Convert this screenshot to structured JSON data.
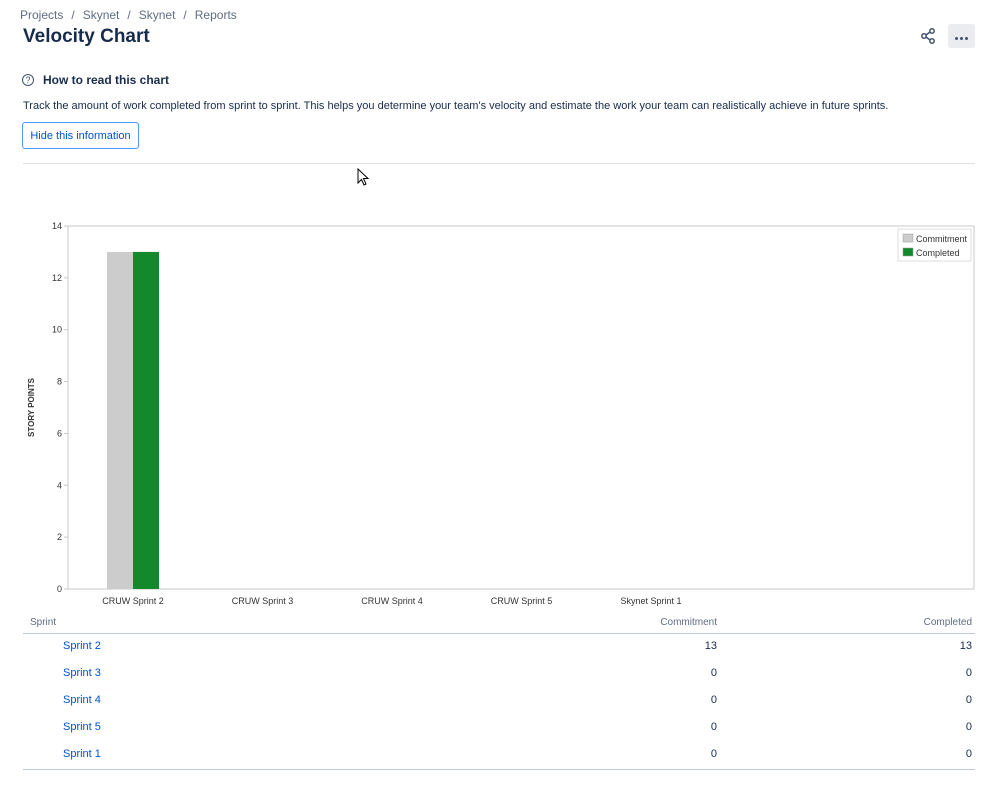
{
  "breadcrumbs": [
    "Projects",
    "Skynet",
    "Skynet",
    "Reports"
  ],
  "page": {
    "title": "Velocity Chart",
    "share_icon": "share-icon",
    "more_icon": "more-horizontal-icon"
  },
  "help": {
    "icon": "question-circle-icon",
    "icon_glyph": "?",
    "title": "How to read this chart",
    "text": "Track the amount of work completed from sprint to sprint. This helps you determine your team's velocity and estimate the work your team can realistically achieve in future sprints.",
    "hide_button": "Hide this information"
  },
  "chart_data": {
    "type": "bar",
    "ylabel": "STORY POINTS",
    "xlabel": "",
    "ylim": [
      0,
      14
    ],
    "yticks": [
      0,
      2,
      4,
      6,
      8,
      10,
      12,
      14
    ],
    "categories": [
      "CRUW Sprint 2",
      "CRUW Sprint 3",
      "CRUW Sprint 4",
      "CRUW Sprint 5",
      "Skynet Sprint 1"
    ],
    "series": [
      {
        "name": "Commitment",
        "values": [
          13,
          0,
          0,
          0,
          0
        ],
        "color": "#cccccc"
      },
      {
        "name": "Completed",
        "values": [
          13,
          0,
          0,
          0,
          0
        ],
        "color": "#14892c"
      }
    ],
    "legend": "top-right",
    "grid": false
  },
  "table": {
    "headers": {
      "sprint": "Sprint",
      "commitment": "Commitment",
      "completed": "Completed"
    },
    "rows": [
      {
        "sprint": "Sprint 2",
        "commitment": "13",
        "completed": "13"
      },
      {
        "sprint": "Sprint 3",
        "commitment": "0",
        "completed": "0"
      },
      {
        "sprint": "Sprint 4",
        "commitment": "0",
        "completed": "0"
      },
      {
        "sprint": "Sprint 5",
        "commitment": "0",
        "completed": "0"
      },
      {
        "sprint": "Sprint 1",
        "commitment": "0",
        "completed": "0"
      }
    ]
  }
}
